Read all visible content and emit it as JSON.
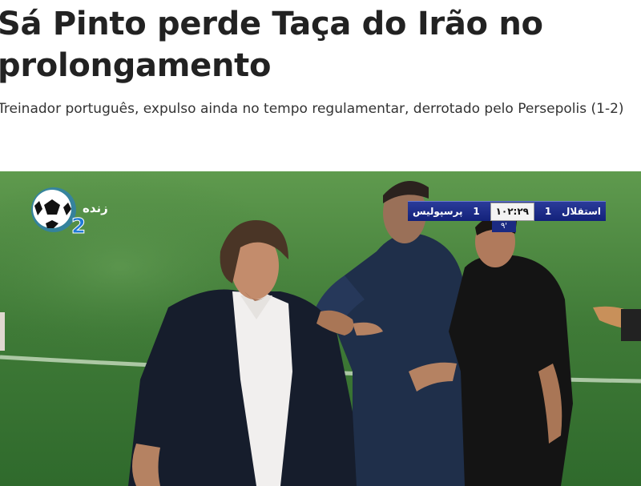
{
  "article": {
    "headline": "Sá Pinto perde Taça do Irão no prolongamento",
    "subtitle": "Treinador português, expulso ainda no tempo regulamentar, derrotado pelo Persepolis (1-2)"
  },
  "broadcast": {
    "channel_name": "زنده",
    "channel_number": "2",
    "scoreboard": {
      "home_team": "استقلال",
      "home_score": "1",
      "clock": "۱۰۲:۲۹",
      "away_score": "1",
      "away_team": "پرسپولیس",
      "minute_indicator": "۹'"
    }
  },
  "colors": {
    "scoreboard_bg": "#13217a",
    "pitch": "#3f7a37"
  }
}
